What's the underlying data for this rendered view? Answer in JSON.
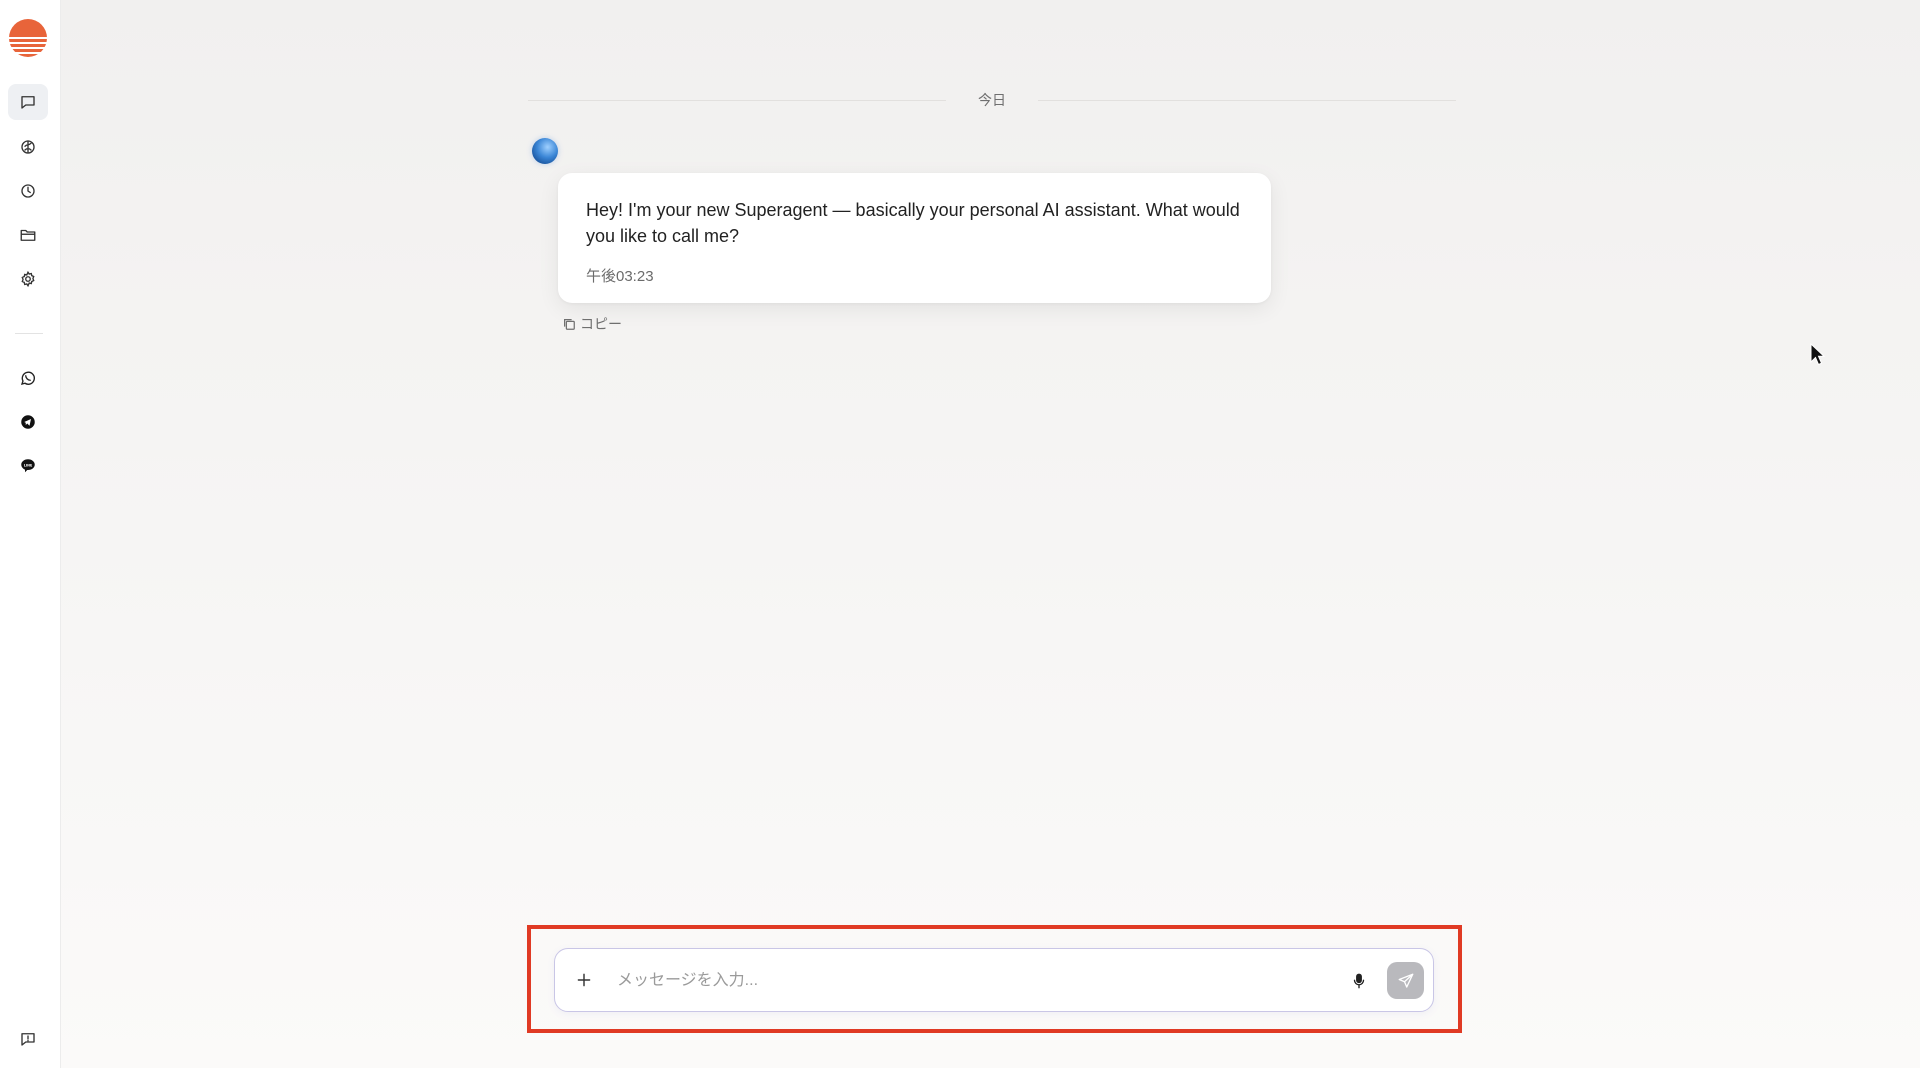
{
  "app": {
    "brand_color": "#e8643a",
    "logo_icon": "sunset-logo-icon"
  },
  "sidebar": {
    "items": [
      {
        "name": "chat",
        "icon": "chat-bubble-icon",
        "active": true
      },
      {
        "name": "brain",
        "icon": "brain-icon",
        "active": false
      },
      {
        "name": "history",
        "icon": "clock-icon",
        "active": false
      },
      {
        "name": "files",
        "icon": "folder-icon",
        "active": false
      },
      {
        "name": "settings",
        "icon": "gear-icon",
        "active": false
      }
    ],
    "integrations": [
      {
        "name": "whatsapp",
        "icon": "whatsapp-icon"
      },
      {
        "name": "telegram",
        "icon": "telegram-icon"
      },
      {
        "name": "line",
        "icon": "line-icon"
      }
    ],
    "feedback_icon": "feedback-icon"
  },
  "chat": {
    "date_label": "今日",
    "messages": [
      {
        "sender": "assistant",
        "text": "Hey! I'm your new Superagent — basically your personal AI assistant. What would you like to call me?",
        "time": "午後03:23",
        "copy_label": "コピー"
      }
    ]
  },
  "composer": {
    "placeholder": "メッセージを入力...",
    "value": "",
    "highlight_color": "#e03a24"
  }
}
